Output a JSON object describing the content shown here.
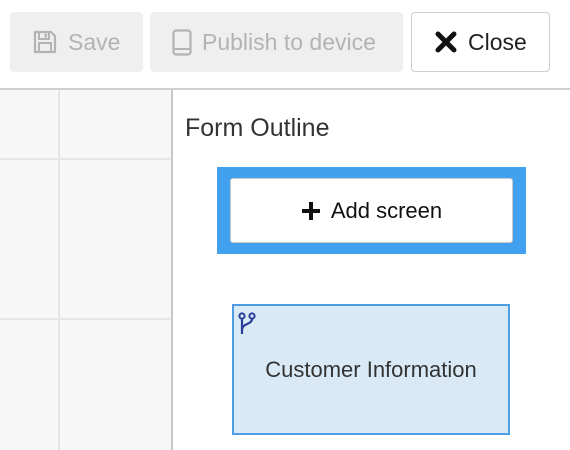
{
  "toolbar": {
    "save": {
      "label": "Save",
      "icon": "save-icon",
      "disabled": true
    },
    "publish": {
      "label": "Publish to device",
      "icon": "device-icon",
      "disabled": true
    },
    "close": {
      "label": "Close",
      "icon": "close-icon"
    }
  },
  "outline": {
    "title": "Form Outline",
    "add_screen": {
      "label": "Add screen",
      "icon": "plus-icon",
      "focused": true
    },
    "screens": [
      {
        "label": "Customer Information",
        "icon": "branch-icon"
      }
    ]
  },
  "colors": {
    "accent": "#41a1ee",
    "card_background": "#d9eaf6",
    "card_border": "#4d9de2",
    "branch_icon": "#2a3f9a",
    "disabled_text": "#b3b3b3"
  }
}
